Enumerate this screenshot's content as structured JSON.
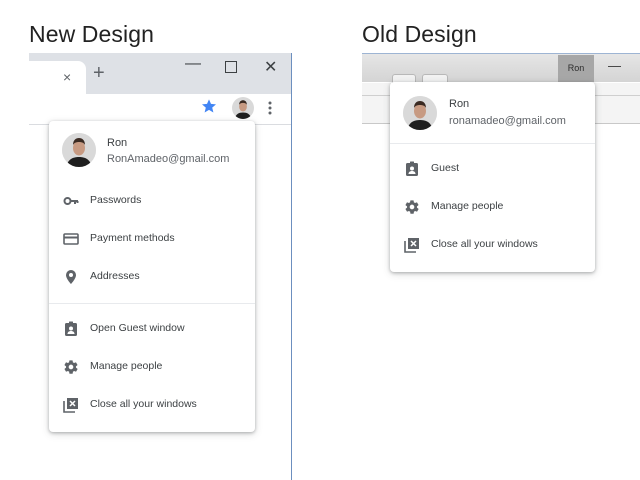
{
  "headings": {
    "new": "New Design",
    "old": "Old Design"
  },
  "new_design": {
    "tab_close_glyph": "×",
    "new_tab_glyph": "+",
    "window_controls": {
      "minimize": "—",
      "close": "✕"
    },
    "profile": {
      "name": "Ron",
      "email": "RonAmadeo@gmail.com"
    },
    "items": [
      {
        "label": "Passwords",
        "icon": "key-icon"
      },
      {
        "label": "Payment methods",
        "icon": "credit-card-icon"
      },
      {
        "label": "Addresses",
        "icon": "location-pin-icon"
      },
      {
        "label": "Open Guest window",
        "icon": "guest-badge-icon"
      },
      {
        "label": "Manage people",
        "icon": "gear-icon"
      },
      {
        "label": "Close all your windows",
        "icon": "close-windows-icon"
      }
    ],
    "accent_color": "#4285f4"
  },
  "old_design": {
    "profile_button_label": "Ron",
    "minimize": "—",
    "profile": {
      "name": "Ron",
      "email": "ronamadeo@gmail.com"
    },
    "items": [
      {
        "label": "Guest",
        "icon": "guest-badge-icon"
      },
      {
        "label": "Manage people",
        "icon": "gear-icon"
      },
      {
        "label": "Close all your windows",
        "icon": "close-windows-icon"
      }
    ]
  }
}
